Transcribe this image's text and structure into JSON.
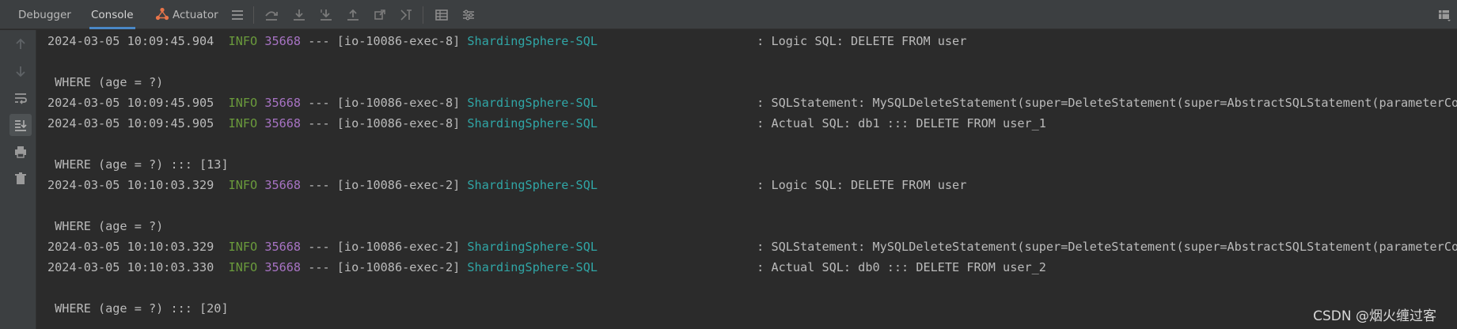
{
  "tabs": [
    {
      "label": "Debugger",
      "active": false
    },
    {
      "label": "Console",
      "active": true
    },
    {
      "label": "Actuator",
      "active": false
    }
  ],
  "toolbar_icons": [
    "menu-icon",
    "step-over-icon",
    "step-into-icon",
    "force-step-into-icon",
    "step-out-icon",
    "run-to-cursor-icon",
    "evaluate-expression-icon",
    "table-icon",
    "settings-list-icon"
  ],
  "gutter_icons": [
    "up-arrow-icon",
    "down-arrow-icon",
    "soft-wrap-icon",
    "scroll-to-end-icon",
    "print-icon",
    "trash-icon"
  ],
  "console": {
    "lines": [
      {
        "type": "log",
        "ts": "2024-03-05 10:09:45.904",
        "level": "INFO",
        "pid": "35668",
        "thread": "--- [io-10086-exec-8]",
        "logger": "ShardingSphere-SQL",
        "msg": ": Logic SQL: DELETE FROM user"
      },
      {
        "type": "text",
        "text": ""
      },
      {
        "type": "text",
        "text": " WHERE (age = ?)"
      },
      {
        "type": "log",
        "ts": "2024-03-05 10:09:45.905",
        "level": "INFO",
        "pid": "35668",
        "thread": "--- [io-10086-exec-8]",
        "logger": "ShardingSphere-SQL",
        "msg": ": SQLStatement: MySQLDeleteStatement(super=DeleteStatement(super=AbstractSQLStatement(parameterCour"
      },
      {
        "type": "log",
        "ts": "2024-03-05 10:09:45.905",
        "level": "INFO",
        "pid": "35668",
        "thread": "--- [io-10086-exec-8]",
        "logger": "ShardingSphere-SQL",
        "msg": ": Actual SQL: db1 ::: DELETE FROM user_1"
      },
      {
        "type": "text",
        "text": ""
      },
      {
        "type": "text",
        "text": " WHERE (age = ?) ::: [13]"
      },
      {
        "type": "log",
        "ts": "2024-03-05 10:10:03.329",
        "level": "INFO",
        "pid": "35668",
        "thread": "--- [io-10086-exec-2]",
        "logger": "ShardingSphere-SQL",
        "msg": ": Logic SQL: DELETE FROM user"
      },
      {
        "type": "text",
        "text": ""
      },
      {
        "type": "text",
        "text": " WHERE (age = ?)"
      },
      {
        "type": "log",
        "ts": "2024-03-05 10:10:03.329",
        "level": "INFO",
        "pid": "35668",
        "thread": "--- [io-10086-exec-2]",
        "logger": "ShardingSphere-SQL",
        "msg": ": SQLStatement: MySQLDeleteStatement(super=DeleteStatement(super=AbstractSQLStatement(parameterCour"
      },
      {
        "type": "log",
        "ts": "2024-03-05 10:10:03.330",
        "level": "INFO",
        "pid": "35668",
        "thread": "--- [io-10086-exec-2]",
        "logger": "ShardingSphere-SQL",
        "msg": ": Actual SQL: db0 ::: DELETE FROM user_2"
      },
      {
        "type": "text",
        "text": ""
      },
      {
        "type": "text",
        "text": " WHERE (age = ?) ::: [20]"
      }
    ]
  },
  "watermark": "CSDN @烟火缠过客",
  "colors": {
    "background": "#2b2b2b",
    "level_info": "#6a9a3c",
    "pid": "#a773c3",
    "logger": "#30a6a6",
    "text": "#bbbbbb"
  }
}
